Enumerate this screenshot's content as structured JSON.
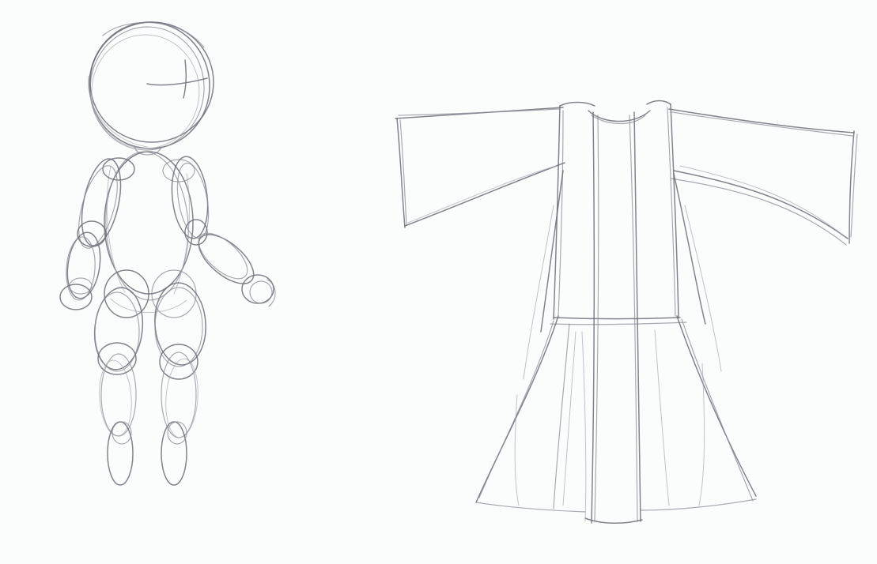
{
  "paper": {
    "background": "#fbfdfd",
    "pencil_color": "#6f6d78"
  },
  "sketches": [
    {
      "name": "mannequin-figure-sketch"
    },
    {
      "name": "robe-sketch"
    }
  ]
}
